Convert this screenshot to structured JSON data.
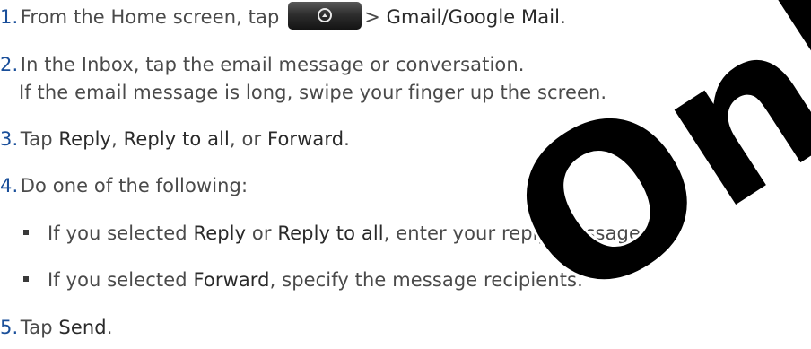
{
  "steps": {
    "s1": {
      "num": "1.",
      "text_a": "From the Home screen, tap",
      "text_b": ">",
      "bold": "Gmail/Google Mail",
      "text_c": ".",
      "button_icon": "home-up-arrow-icon"
    },
    "s2": {
      "num": "2.",
      "text": "In the Inbox, tap the email message or conversation.",
      "text2": "If the email message is long, swipe your finger up the screen."
    },
    "s3": {
      "num": "3.",
      "text_a": "Tap",
      "bold1": "Reply",
      "sep1": ",",
      "bold2": "Reply to all",
      "sep2": ", or",
      "bold3": "Forward",
      "text_end": "."
    },
    "s4": {
      "num": "4.",
      "text": "Do one of the following:"
    },
    "b1": {
      "text_a": "If you selected",
      "bold1": "Reply",
      "text_b": "or",
      "bold2": "Reply to all",
      "text_c": ", enter your reply message."
    },
    "b2": {
      "text_a": "If you selected",
      "bold1": "Forward",
      "text_b": ", specify the message recipients."
    },
    "s5": {
      "num": "5.",
      "text_a": "Tap",
      "bold": "Send",
      "text_end": "."
    }
  },
  "watermark": {
    "text": "Only",
    "color": "#000000"
  },
  "colors": {
    "body_text": "#4a4a4a",
    "number_blue": "#1a4f9a"
  }
}
